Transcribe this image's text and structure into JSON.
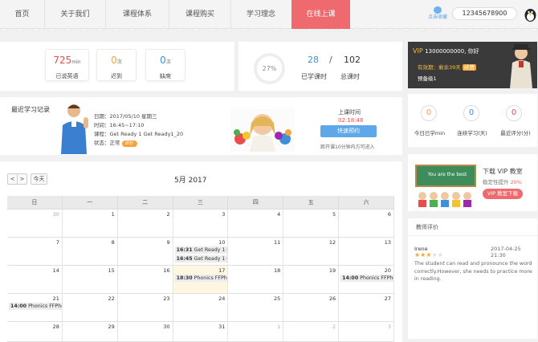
{
  "nav": {
    "items": [
      "首页",
      "关于我们",
      "课程体系",
      "课程购买",
      "学习理念",
      "在线上课"
    ],
    "favorite": "点击收藏",
    "phone": "12345678900"
  },
  "stats": {
    "completed": {
      "value": "725",
      "unit": "min",
      "label": "已说英语"
    },
    "late": {
      "value": "0",
      "unit": "次",
      "label": "迟到"
    },
    "absent": {
      "value": "0",
      "unit": "次",
      "label": "缺席"
    },
    "progress_percent": "27%",
    "progress_fraction": 0.27,
    "studied": "28",
    "slash": "/",
    "total": "102",
    "studied_label": "已学课时",
    "total_label": "总课时"
  },
  "record": {
    "title": "最近学习记录",
    "date": "日期：2017/05/10 星期三",
    "time": "时间：16:45~17:10",
    "course": "课程：Get Ready 1 Get Ready1_20",
    "status_prefix": "状态：正常",
    "status_pill": "评价",
    "class_time_label": "上课时间",
    "countdown": "02:18:48",
    "book_button": "快速预约",
    "note": "距开课10分钟内方可进入"
  },
  "calendar": {
    "prev": "<",
    "next": ">",
    "today": "今天",
    "title": "5月 2017",
    "weekdays": [
      "日",
      "一",
      "二",
      "三",
      "四",
      "五",
      "六"
    ],
    "weeks": [
      [
        {
          "d": "30",
          "o": true
        },
        {
          "d": "1"
        },
        {
          "d": "2"
        },
        {
          "d": "3"
        },
        {
          "d": "4"
        },
        {
          "d": "5"
        },
        {
          "d": "6"
        }
      ],
      [
        {
          "d": "7"
        },
        {
          "d": "8"
        },
        {
          "d": "9"
        },
        {
          "d": "10",
          "ev": [
            {
              "t": "16:31",
              "n": "Get Ready 1 Ge"
            },
            {
              "t": "16:45",
              "n": "Get Ready 1 Ge"
            }
          ]
        },
        {
          "d": "11"
        },
        {
          "d": "12"
        },
        {
          "d": "13"
        }
      ],
      [
        {
          "d": "14"
        },
        {
          "d": "15"
        },
        {
          "d": "16"
        },
        {
          "d": "17",
          "today": true,
          "ev": [
            {
              "t": "18:30",
              "n": "Phonics FFPhon"
            }
          ]
        },
        {
          "d": "18"
        },
        {
          "d": "19"
        },
        {
          "d": "20",
          "ev": [
            {
              "t": "14:00",
              "n": "Phonics FFPhon"
            }
          ]
        }
      ],
      [
        {
          "d": "21",
          "ev": [
            {
              "t": "14:00",
              "n": "Phonics FFPhon"
            }
          ]
        },
        {
          "d": "22"
        },
        {
          "d": "23"
        },
        {
          "d": "24"
        },
        {
          "d": "25"
        },
        {
          "d": "26"
        },
        {
          "d": "27"
        }
      ],
      [
        {
          "d": "28"
        },
        {
          "d": "29"
        },
        {
          "d": "30"
        },
        {
          "d": "31"
        },
        {
          "d": "1",
          "o": true
        },
        {
          "d": "2",
          "o": true
        },
        {
          "d": "3",
          "o": true
        }
      ]
    ]
  },
  "vip": {
    "title": "VIP",
    "greeting": "13000000000, 你好",
    "validity": "有效期：剩余39天",
    "renew": "续费",
    "level": "预备级1"
  },
  "right_stats": [
    {
      "value": "0",
      "label": "今日已学min"
    },
    {
      "value": "0",
      "label": "连续学习(天)"
    },
    {
      "value": "0",
      "label": "最近评分(分)"
    }
  ],
  "download": {
    "title": "下载 VIP 教室",
    "subtitle": "稳定性提升",
    "percent": "20%",
    "button": "VIP 教室下载",
    "board_text": "You are the best"
  },
  "evaluation": {
    "header": "教师评价",
    "teacher": "Irene",
    "timestamp": "2017-04-25 21:30",
    "stars": 3,
    "max_stars": 5,
    "comment": "The student can read and pronounce the word correctly.However, she needs to practice more in reading."
  },
  "colors": {
    "accent_red": "#ef6a6f",
    "orange": "#f4a63a",
    "blue": "#3f8fd8",
    "gold": "#f2b84a"
  }
}
